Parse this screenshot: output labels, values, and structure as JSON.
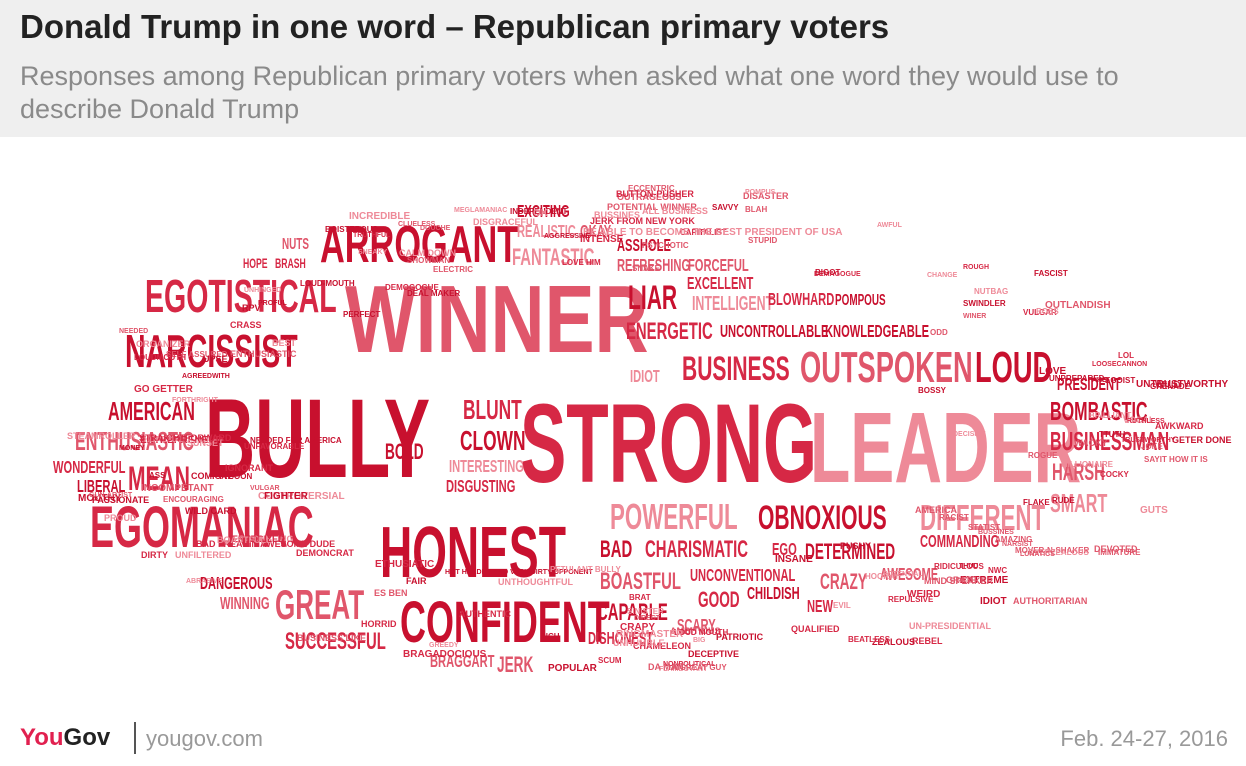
{
  "header": {
    "title": "Donald Trump in one word – Republican primary voters",
    "subtitle": "Responses among Republican primary voters when asked what one word they would use to describe Donald Trump"
  },
  "footer": {
    "logo_you": "You",
    "logo_gov": "Gov",
    "site": "yougov.com",
    "date": "Feb. 24-27, 2016"
  },
  "colors": {
    "dark_red": "#c8102e",
    "red": "#d62845",
    "pink": "#e0566b",
    "light_pink": "#ee8a98",
    "header_bg": "#efefef"
  },
  "words": [
    {
      "text": "WINNER",
      "size": 96
    },
    {
      "text": "BULLY",
      "size": 112
    },
    {
      "text": "STRONG",
      "size": 112
    },
    {
      "text": "LEADER",
      "size": 100
    },
    {
      "text": "HONEST",
      "size": 72
    },
    {
      "text": "EGOMANIAC",
      "size": 58
    },
    {
      "text": "CONFIDENT",
      "size": 58
    },
    {
      "text": "ARROGANT",
      "size": 52
    },
    {
      "text": "EGOTISTICAL",
      "size": 46
    },
    {
      "text": "NARCISSIST",
      "size": 46
    },
    {
      "text": "OUTSPOKEN",
      "size": 44
    },
    {
      "text": "LOUD",
      "size": 44
    },
    {
      "text": "GREAT",
      "size": 42
    },
    {
      "text": "POWERFUL",
      "size": 36
    },
    {
      "text": "DIFFERENT",
      "size": 36
    },
    {
      "text": "OBNOXIOUS",
      "size": 34
    },
    {
      "text": "BUSINESS",
      "size": 34
    },
    {
      "text": "LIAR",
      "size": 34
    },
    {
      "text": "MEAN",
      "size": 34
    },
    {
      "text": "BLUNT",
      "size": 28
    },
    {
      "text": "CLOWN",
      "size": 28
    },
    {
      "text": "BOMBASTIC",
      "size": 26
    },
    {
      "text": "BUSINESSMAN",
      "size": 26
    },
    {
      "text": "AMERICAN",
      "size": 26
    },
    {
      "text": "ENTHUSIASTIC",
      "size": 26
    },
    {
      "text": "SMART",
      "size": 26
    },
    {
      "text": "HARSH",
      "size": 24
    },
    {
      "text": "FANTASTIC",
      "size": 24
    },
    {
      "text": "ENERGETIC",
      "size": 24
    },
    {
      "text": "CAPABLE",
      "size": 24
    },
    {
      "text": "SUCCESSFUL",
      "size": 24
    },
    {
      "text": "BOASTFUL",
      "size": 24
    },
    {
      "text": "CHARISMATIC",
      "size": 24
    },
    {
      "text": "BAD",
      "size": 24
    },
    {
      "text": "DETERMINED",
      "size": 22
    },
    {
      "text": "CRAZY",
      "size": 22
    },
    {
      "text": "JERK",
      "size": 22
    },
    {
      "text": "BOLD",
      "size": 22
    },
    {
      "text": "GOOD",
      "size": 22
    },
    {
      "text": "INTELLIGENT",
      "size": 20
    },
    {
      "text": "EXCELLENT",
      "size": 18
    },
    {
      "text": "FORCEFUL",
      "size": 18
    },
    {
      "text": "EXCITING",
      "size": 18
    },
    {
      "text": "REALISTIC",
      "size": 18
    },
    {
      "text": "OKAY",
      "size": 18
    },
    {
      "text": "ASSHOLE",
      "size": 18
    },
    {
      "text": "REFRESHING",
      "size": 18
    },
    {
      "text": "IDIOT",
      "size": 18
    },
    {
      "text": "UNCONTROLLABLE",
      "size": 18
    },
    {
      "text": "KNOWLEDGEABLE",
      "size": 18
    },
    {
      "text": "BLOWHARD",
      "size": 18
    },
    {
      "text": "POMPOUS",
      "size": 16
    },
    {
      "text": "INTERESTING",
      "size": 18
    },
    {
      "text": "DISGUSTING",
      "size": 18
    },
    {
      "text": "WONDERFUL",
      "size": 18
    },
    {
      "text": "LIBERAL",
      "size": 18
    },
    {
      "text": "PRESIDENT",
      "size": 18
    },
    {
      "text": "COMMANDING",
      "size": 18
    },
    {
      "text": "AWESOME",
      "size": 18
    },
    {
      "text": "UNCONVENTIONAL",
      "size": 18
    },
    {
      "text": "CHILDISH",
      "size": 18
    },
    {
      "text": "DANGEROUS",
      "size": 18
    },
    {
      "text": "WINNING",
      "size": 18
    },
    {
      "text": "DISHONEST",
      "size": 18
    },
    {
      "text": "BRAGGART",
      "size": 18
    },
    {
      "text": "SCARY",
      "size": 18
    },
    {
      "text": "NEW",
      "size": 18
    },
    {
      "text": "EGO",
      "size": 18
    },
    {
      "text": "NUTS",
      "size": 16
    },
    {
      "text": "HOPE",
      "size": 14
    },
    {
      "text": "BRASH",
      "size": 14
    }
  ],
  "small_words": [
    "MONEY",
    "CHAMELEON",
    "DEVOTED",
    "TROUBLING",
    "DEAL MAKER",
    "NONPOLITICAL",
    "SELF ASSURED",
    "GUTS",
    "EXTREME",
    "QUALIFIED",
    "SHOWMAN",
    "BRILLIANT",
    "AGREEDWITH",
    "CAPITALIST",
    "IMMATURE",
    "NUTBAG",
    "RPV",
    "DEMOGOGUE",
    "VULGAR",
    "UNFILTERED",
    "UNPREPARED",
    "ENTREPRENEUR",
    "ENCOURAGING",
    "FLAMBOYANT",
    "POPULAR",
    "WILD",
    "POTENTIAL WINNER",
    "MILLIONAIRE",
    "PATRIOTIC",
    "INTENSE",
    "WACKY",
    "CONTROVERSIAL",
    "PASSIONATE",
    "IGNORANT",
    "WINER",
    "UN-PRESIDENTIAL",
    "BOISTEROUS",
    "DEMAGOGUE",
    "AMERICA",
    "AWFUL",
    "NEEDED FOR AMERICA",
    "UNFAVORABLE",
    "AMBITIOUS",
    "POTENTIAL",
    "PERFECT",
    "NWC",
    "JOKE",
    "BE ABLE TO BECOME THE BEST PRESIDENT OF USA",
    "INDEPENDENT",
    "ETHUSIATIC",
    "RACIST",
    "UNTHOUGHTFUL",
    "WILD CARD",
    "VULGAR",
    "AUTHORITARIAN",
    "STEAMROLLER",
    "MOUTHY",
    "BAD FREAKIN AWESOME DUDE",
    "DISASTER",
    "VOCAL",
    "FIGHTER",
    "LOUDMOUTH",
    "OUTRAGEOUS",
    "PROUD",
    "RUDE",
    "RUTHLESS",
    "ELECTRIC",
    "FORTHRIGHT",
    "FAKE",
    "DEMONCRAT",
    "A GREAT GUY",
    "BOSS",
    "BIGOT",
    "DIRTY",
    "STATIST",
    "UNHUMBLE",
    "HOT HEADED AND VERY DIRTY OPPONENT",
    "JERK FROM NEW YORK",
    "ODD",
    "BIG",
    "IDIOT",
    "COCKY",
    "ES BEN",
    "SUNSET",
    "FASCIST",
    "LOL",
    "BUSSINES",
    "OK",
    "RICH",
    "REBEL",
    "BLAH",
    "BEST",
    "EGOIST",
    "HORRID",
    "GRATE",
    "BUSSINES",
    "PROFUL",
    "WEIRD",
    "ECCENTRIC",
    "CHANGE",
    "SWINDLER",
    "BRAT",
    "BUSINESS LIKE",
    "UNHINGED",
    "TYCOON",
    "AUTHENTIC",
    "ENTHUSIASTIC",
    "SNEAKY",
    "TTUTH",
    "TRUSTWORTHY",
    "AMAZING",
    "INCREDIBLE",
    "INSANE",
    "AWKWARD",
    "NEEDED",
    "GREEDY",
    "LOUD-MOUTH",
    "LOOSECANNON",
    "CLUELESS",
    "SINISTER",
    "FLAKE",
    "GO GETTER",
    "NARSIST",
    "HOORAY",
    "THUD",
    "ENERGIZED",
    "INCOMPETANT",
    "CALM DOWN",
    "COMICAL",
    "SCUM",
    "GUN-ARTIST",
    "HOPEFUL",
    "SAVVY",
    "LOVE HIM",
    "SNAKE",
    "PETULANT BULLY",
    "AGGRESSIVE",
    "STRAIGHTFORWARD",
    "SAYIT HOW IT IS",
    "MEGLAMANIAC",
    "UNTRUSTWORTHY",
    "LOUD MOUTH",
    "OUTLANDISH",
    "BOASTFULL",
    "ZEALOUS",
    "CRASS",
    "MOVER-N-SHAKER",
    "OVERZEALOUS",
    "GETER DONE",
    "CRAPY",
    "DA MAN",
    "ABRASIVE",
    "PUSHY",
    "ROUGH",
    "ROGUE",
    "DECISIVE",
    "DECEPTIVE",
    "RIDICULOUS",
    "LUNATICS",
    "ORGANIZER",
    "LOVE",
    "TRUTHFUL",
    "MIND SPEAKER",
    "ALL BUSINESS",
    "GRENADE",
    "BEATLESS",
    "STUPID",
    "RINGMASTER",
    "BOSSY",
    "BRAGADOCIOUS",
    "PSYCHOTIC",
    "DISGRACEFUL",
    "UPSET",
    "BUTTON-PUSHER",
    "DOUCHE",
    "POMPUS",
    "ASS",
    "REPULSIVE",
    "DIRECT",
    "EVIL",
    "FAIR"
  ]
}
